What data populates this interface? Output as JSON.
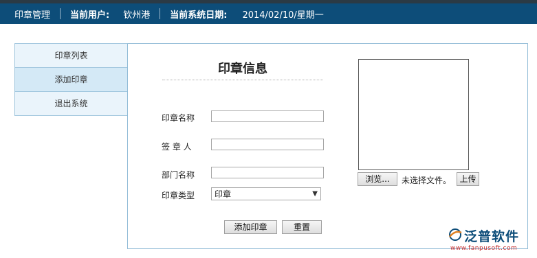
{
  "header": {
    "app_name": "印章管理",
    "user_label": "当前用户:",
    "user_value": "钦州港",
    "date_label": "当前系统日期:",
    "date_value": "2014/02/10/星期一"
  },
  "sidebar": {
    "items": [
      {
        "label": "印章列表"
      },
      {
        "label": "添加印章"
      },
      {
        "label": "退出系统"
      }
    ]
  },
  "form": {
    "title": "印章信息",
    "fields": {
      "seal_name": {
        "label": "印章名称",
        "value": ""
      },
      "signer": {
        "label": "签 章 人",
        "value": ""
      },
      "department": {
        "label": "部门名称",
        "value": ""
      },
      "seal_type": {
        "label": "印章类型",
        "selected": "印章"
      }
    },
    "submit_label": "添加印章",
    "reset_label": "重置"
  },
  "upload": {
    "browse_label": "浏览...",
    "file_status": "未选择文件。",
    "upload_label": "上传"
  },
  "logo": {
    "name": "泛普软件",
    "url_text": "www.fanpusoft.com"
  },
  "colors": {
    "header_bg": "#0d4d79",
    "menu_bg": "#eaf4fb",
    "border": "#9cc3dc"
  }
}
